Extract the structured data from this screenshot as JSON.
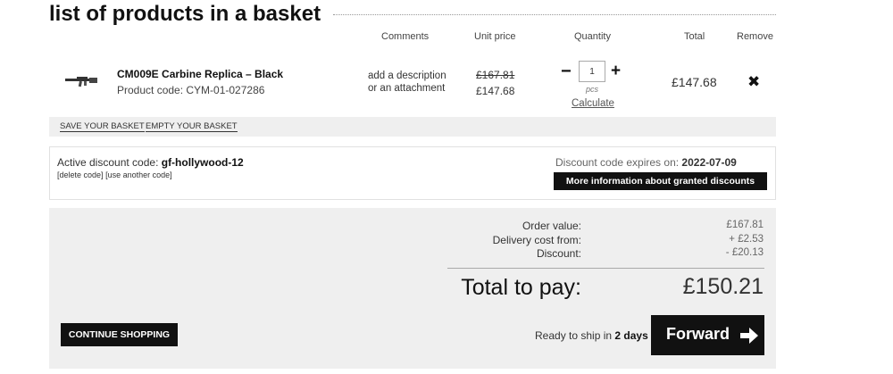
{
  "page": {
    "title": "list of products in a basket"
  },
  "table_headers": {
    "comments": "Comments",
    "unit_price": "Unit price",
    "quantity": "Quantity",
    "total": "Total",
    "remove": "Remove"
  },
  "item": {
    "name": "CM009E Carbine Replica – Black",
    "code": "Product code: CYM-01-027286",
    "comments_line1": "add a description",
    "comments_line2": "or an attachment",
    "price_old": "£167.81",
    "price_new": "£147.68",
    "quantity": "1",
    "qty_unit": "pcs",
    "calculate_label": "Calculate",
    "minus": "−",
    "plus": "+",
    "total": "£147.68",
    "remove_symbol": "✖",
    "image_icon": "rifle-icon"
  },
  "basket_actions": {
    "save": "SAVE YOUR BASKET",
    "empty": "EMPTY YOUR BASKET"
  },
  "discount": {
    "label": "Active discount code: ",
    "code": "gf-hollywood-12",
    "delete_link": "[delete code]",
    "use_another_link": "[use another code]",
    "expiry_label": "Discount code expires on: ",
    "expiry_date": "2022-07-09",
    "more_info_button": "More information about granted discounts"
  },
  "summary": {
    "order_value_label": "Order value:",
    "order_value": "£167.81",
    "delivery_label": "Delivery cost from:",
    "delivery": "+ £2.53",
    "discount_label": "Discount:",
    "discount": "- £20.13",
    "total_label": "Total to pay:",
    "total": "£150.21"
  },
  "footer": {
    "continue_button": "CONTINUE SHOPPING",
    "ship_prefix": "Ready to ship in ",
    "ship_days": "2 days",
    "forward_button": "Forward",
    "forward_icon": "arrow-right-icon"
  }
}
